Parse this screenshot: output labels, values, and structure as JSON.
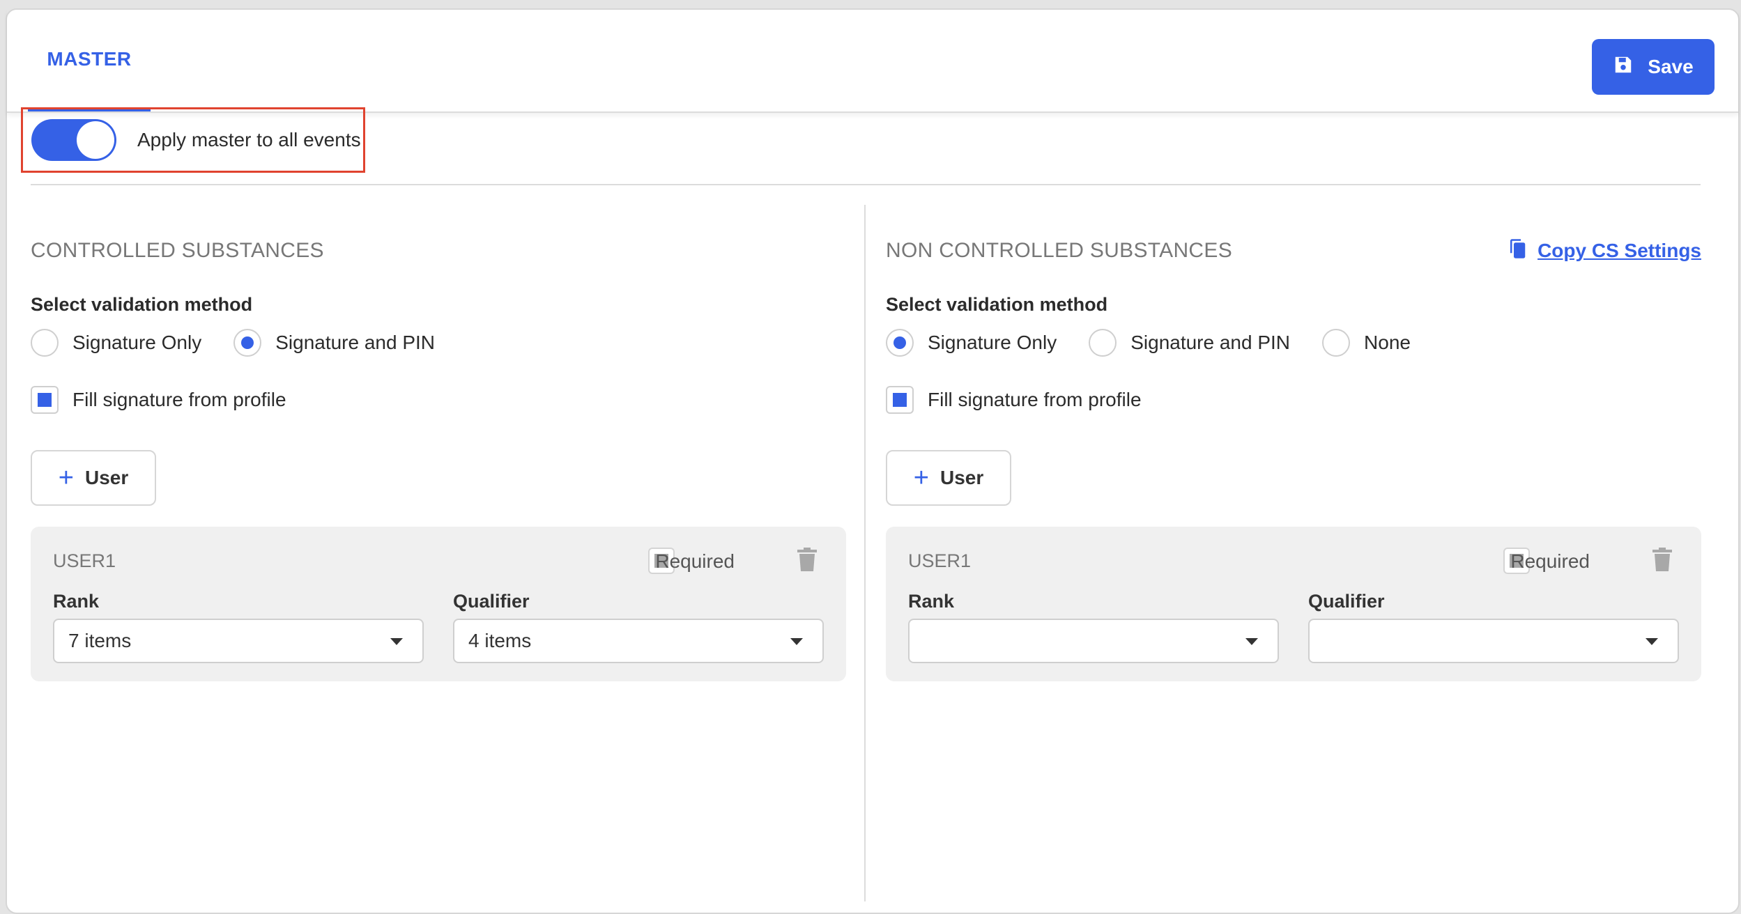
{
  "header": {
    "tab_master": "MASTER",
    "save_label": "Save",
    "brand_color": "#3561e6"
  },
  "apply_toggle": {
    "label": "Apply master to all events",
    "on": true
  },
  "controlled": {
    "title": "CONTROLLED SUBSTANCES",
    "validation_label": "Select validation method",
    "options": [
      {
        "label": "Signature Only",
        "checked": false
      },
      {
        "label": "Signature and PIN",
        "checked": true
      }
    ],
    "fill_signature_label": "Fill signature from profile",
    "user_button_label": "User",
    "user_card": {
      "name": "USER1",
      "required_label": "Required",
      "rank_label": "Rank",
      "rank_value": "7 items",
      "qualifier_label": "Qualifier",
      "qualifier_value": "4 items"
    }
  },
  "non_controlled": {
    "title": "NON CONTROLLED SUBSTANCES",
    "copy_link": "Copy CS Settings",
    "validation_label": "Select validation method",
    "options": [
      {
        "label": "Signature Only",
        "checked": true
      },
      {
        "label": "Signature and PIN",
        "checked": false
      },
      {
        "label": "None",
        "checked": false
      }
    ],
    "fill_signature_label": "Fill signature from profile",
    "user_button_label": "User",
    "user_card": {
      "name": "USER1",
      "required_label": "Required",
      "rank_label": "Rank",
      "rank_value": "",
      "qualifier_label": "Qualifier",
      "qualifier_value": ""
    }
  }
}
